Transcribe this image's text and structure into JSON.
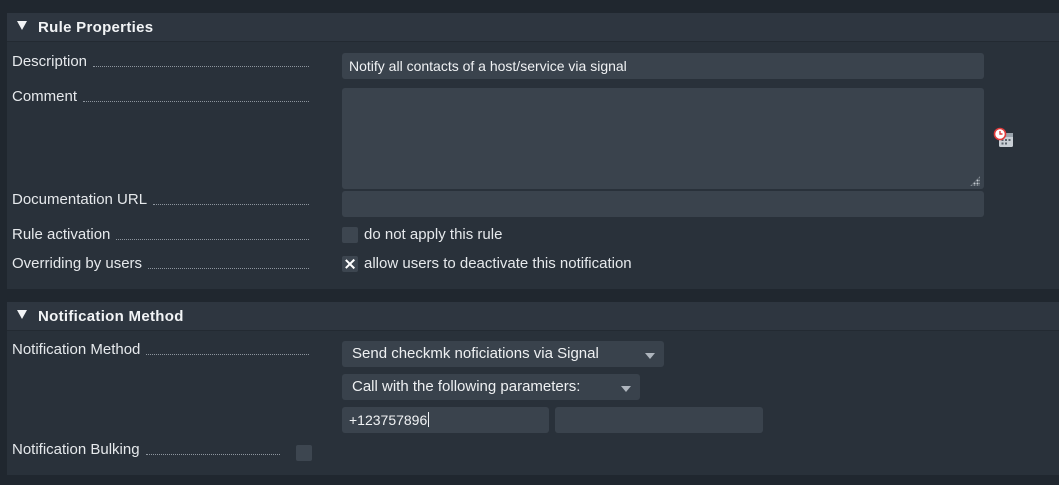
{
  "rule_properties": {
    "title": "Rule Properties",
    "description_label": "Description",
    "description_value": "Notify all contacts of a host/service via signal",
    "comment_label": "Comment",
    "comment_value": "",
    "doc_url_label": "Documentation URL",
    "doc_url_value": "",
    "activation_label": "Rule activation",
    "activation_checkbox_text": "do not apply this rule",
    "activation_checked": false,
    "override_label": "Overriding by users",
    "override_checkbox_text": "allow users to deactivate this notification",
    "override_checked": true,
    "history_icon": "clock-calendar-icon"
  },
  "notification_method": {
    "title": "Notification Method",
    "method_label": "Notification Method",
    "method_select": "Send checkmk noficiations via Signal",
    "params_select": "Call with the following parameters:",
    "param1_value": "+123757896",
    "param2_value": "",
    "bulking_label": "Notification Bulking",
    "bulking_checked": false
  },
  "colors": {
    "background": "#20272f",
    "panel": "#29313a",
    "input": "#3a434d",
    "accent_red": "#e03a3a"
  }
}
